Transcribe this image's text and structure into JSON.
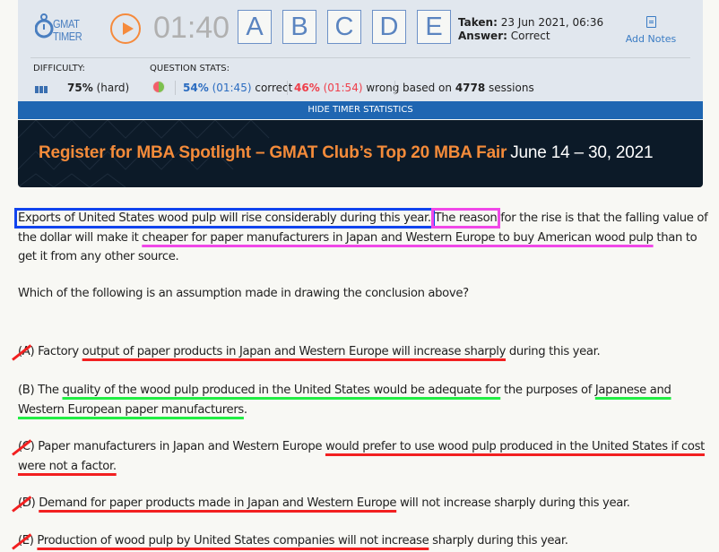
{
  "timer": {
    "logo_line1": "GMAT",
    "logo_line2": "TIMER",
    "time": "01:40",
    "answer_buttons": [
      "A",
      "B",
      "C",
      "D",
      "E"
    ],
    "taken_label": "Taken:",
    "taken_value": "23 Jun 2021, 06:36",
    "answer_label": "Answer:",
    "answer_value": "Correct",
    "add_notes": "Add Notes"
  },
  "stats": {
    "difficulty_label": "DIFFICULTY:",
    "difficulty_pct": "75%",
    "difficulty_level": "(hard)",
    "question_stats_label": "QUESTION STATS:",
    "correct_pct": "54%",
    "correct_time": "(01:45)",
    "correct_label": "correct",
    "wrong_pct": "46%",
    "wrong_time": "(01:54)",
    "wrong_label": "wrong",
    "based_on_prefix": "based on",
    "sessions_count": "4778",
    "sessions_label": "sessions",
    "hide_button": "HIDE TIMER STATISTICS",
    "colors": {
      "correct": "#2b6cc0",
      "wrong": "#ef3e4a"
    }
  },
  "banner": {
    "headline": "Register for MBA Spotlight – GMAT Club’s Top 20 MBA Fair",
    "dates": "June 14 – 30, 2021"
  },
  "passage": {
    "conclusion": "Exports of United States wood pulp will rise considerably during this year.",
    "reason_keyword": "The reason",
    "mid": " for the rise is that the falling value of the dollar will make it ",
    "premise": "cheaper for paper manufacturers in Japan and Western Europe to buy American wood pulp",
    "tail": " than to get it from any other source."
  },
  "question": "Which of the following is an assumption made in drawing the conclusion above?",
  "options": [
    {
      "letter": "(A)",
      "pre": " Factory ",
      "marked": "output of paper products in Japan and Western Europe will increase sharply",
      "post": " during this year.",
      "eliminated": true
    },
    {
      "letter": "(B)",
      "pre": " The ",
      "marked": "quality of the wood pulp produced in the United States would be adequate for",
      "mid": " the purposes of ",
      "marked2": "Japanese and Western European paper manufacturers",
      "post": ".",
      "eliminated": false
    },
    {
      "letter": "(C)",
      "pre": " Paper manufacturers in Japan and Western Europe ",
      "marked": "would prefer to use wood pulp produced in the United States if cost were not a factor.",
      "post": "",
      "eliminated": true
    },
    {
      "letter": "(D)",
      "pre": " ",
      "marked": "Demand for paper products made in Japan and Western Europe",
      "post": " will not increase sharply during this year.",
      "eliminated": true
    },
    {
      "letter": "(E)",
      "pre": " ",
      "marked": "Production of wood pulp by United States companies will not increase",
      "post": " sharply during this year.",
      "eliminated": true
    }
  ]
}
